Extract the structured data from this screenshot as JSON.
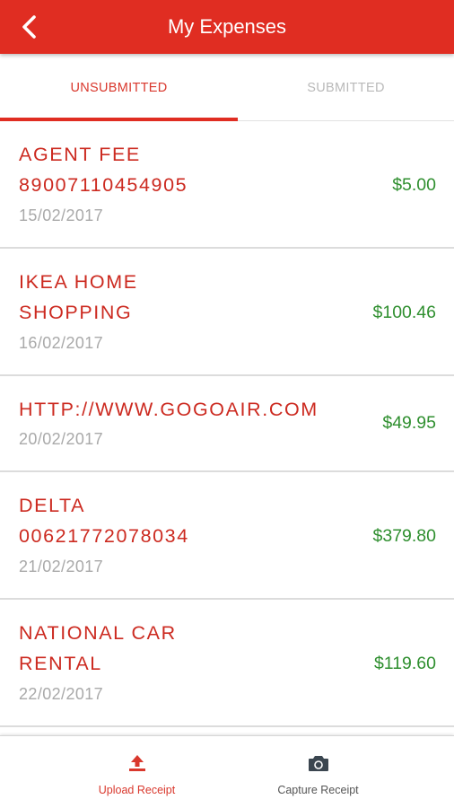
{
  "header": {
    "title": "My Expenses"
  },
  "tabs": [
    {
      "label": "UNSUBMITTED",
      "active": true
    },
    {
      "label": "SUBMITTED",
      "active": false
    }
  ],
  "expenses": [
    {
      "name": "AGENT FEE\n89007110454905",
      "date": "15/02/2017",
      "amount": "$5.00"
    },
    {
      "name": "IKEA HOME\nSHOPPING",
      "date": "16/02/2017",
      "amount": "$100.46"
    },
    {
      "name": "HTTP://WWW.GOGOAIR.COM",
      "date": "20/02/2017",
      "amount": "$49.95"
    },
    {
      "name": "DELTA\n00621772078034",
      "date": "21/02/2017",
      "amount": "$379.80"
    },
    {
      "name": "NATIONAL CAR\nRENTAL",
      "date": "22/02/2017",
      "amount": "$119.60"
    }
  ],
  "bottom_bar": {
    "upload_label": "Upload Receipt",
    "capture_label": "Capture Receipt"
  },
  "icons": {
    "back": "chevron-left-icon",
    "upload": "upload-icon",
    "capture": "camera-icon"
  },
  "colors": {
    "header": "#e02d22",
    "accent_red": "#d9382d",
    "amount_green": "#2f8f2f",
    "date_gray": "#a9a9a9",
    "inactive_tab": "#b9b9b9"
  }
}
